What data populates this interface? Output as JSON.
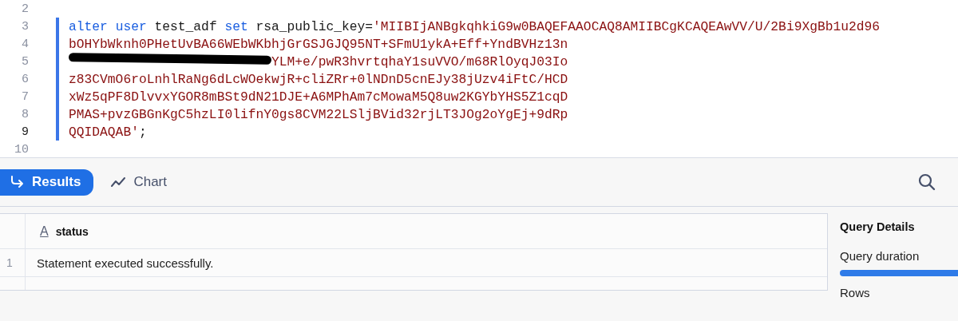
{
  "editor": {
    "lines": [
      {
        "number": "2",
        "current": false,
        "in_statement": false
      },
      {
        "number": "3",
        "current": false,
        "in_statement": true,
        "tokens": [
          {
            "kind": "keyword",
            "text": "alter"
          },
          {
            "kind": "keyword",
            "text": "user",
            "space_before": true
          },
          {
            "kind": "plain",
            "text": "test_adf",
            "space_before": true
          },
          {
            "kind": "keyword",
            "text": "set",
            "space_before": true
          },
          {
            "kind": "plain",
            "text": "rsa_public_key=",
            "space_before": true
          },
          {
            "kind": "string",
            "text": "'MIIBIjANBgkqhkiG9w0BAQEFAAOCAQ8AMIIBCgKCAQEAwVV/U/2Bi9XgBb1u2d96"
          }
        ]
      },
      {
        "number": "4",
        "current": false,
        "in_statement": true,
        "tokens": [
          {
            "kind": "string",
            "text": "bOHYbWknh0PHetUvBA66WEbWKbhjGrGSJGJQ95NT+SFmU1ykA+Eff+YndBVHz13n"
          }
        ]
      },
      {
        "number": "5",
        "current": false,
        "in_statement": true,
        "tokens": [
          {
            "kind": "redaction"
          },
          {
            "kind": "string",
            "text": "YLM+e/pwR3hvrtqhaY1suVVO/m68RlOyqJ03Io"
          }
        ]
      },
      {
        "number": "6",
        "current": false,
        "in_statement": true,
        "tokens": [
          {
            "kind": "string",
            "text": "z83CVmO6roLnhlRaNg6dLcWOekwjR+cliZRr+0lNDnD5cnEJy38jUzv4iFtC/HCD"
          }
        ]
      },
      {
        "number": "7",
        "current": false,
        "in_statement": true,
        "tokens": [
          {
            "kind": "string",
            "text": "xWz5qPF8DlvvxYGOR8mBSt9dN21DJE+A6MPhAm7cMowaM5Q8uw2KGYbYHS5Z1cqD"
          }
        ]
      },
      {
        "number": "8",
        "current": false,
        "in_statement": true,
        "tokens": [
          {
            "kind": "string",
            "text": "PMAS+pvzGBGnKgC5hzLI0lifnY0gs8CVM22LSljBVid32rjLT3JOg2oYgEj+9dRp"
          }
        ]
      },
      {
        "number": "9",
        "current": true,
        "in_statement": true,
        "tokens": [
          {
            "kind": "string",
            "text": "QQIDAQAB'"
          },
          {
            "kind": "plain",
            "text": ";"
          }
        ]
      },
      {
        "number": "10",
        "current": false,
        "in_statement": false
      }
    ]
  },
  "tabs": [
    {
      "label": "Results",
      "kind": "results",
      "selected": true
    },
    {
      "label": "Chart",
      "kind": "chart",
      "selected": false
    }
  ],
  "table": {
    "columns": [
      {
        "type_icon": "A",
        "label": "status"
      }
    ],
    "rows": [
      {
        "number": "1",
        "cells": [
          "Statement executed successfully."
        ]
      }
    ]
  },
  "details": {
    "title": "Query Details",
    "items": [
      {
        "label": "Query duration",
        "kind": "bar"
      },
      {
        "label": "Rows",
        "kind": "text"
      }
    ]
  }
}
